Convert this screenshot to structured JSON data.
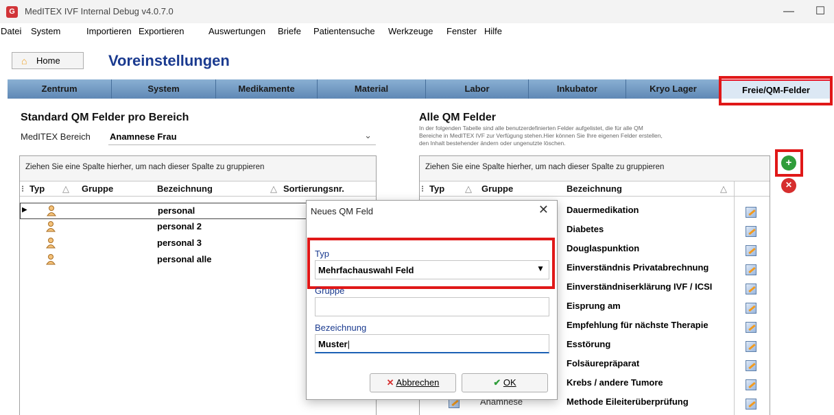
{
  "window": {
    "title": "MedITEX IVF Internal Debug v4.0.7.0",
    "minimize_glyph": "—",
    "maximize_glyph": "☐"
  },
  "menu": [
    "Datei",
    "System",
    "Importieren",
    "Exportieren",
    "Auswertungen",
    "Briefe",
    "Patientensuche",
    "Werkzeuge",
    "Fenster",
    "Hilfe"
  ],
  "home_label": "Home",
  "page_title": "Voreinstellungen",
  "tabs": [
    "Zentrum",
    "System",
    "Medikamente",
    "Material",
    "Labor",
    "Inkubator",
    "Kryo Lager",
    "Freie/QM-Felder"
  ],
  "active_tab": "Freie/QM-Felder",
  "left": {
    "title": "Standard QM Felder pro Bereich",
    "bereich_label": "MedITEX Bereich",
    "bereich_value": "Anamnese Frau",
    "group_hint": "Ziehen Sie eine Spalte hierher, um nach dieser Spalte zu gruppieren",
    "columns": {
      "typ": "Typ",
      "gruppe": "Gruppe",
      "bezeichnung": "Bezeichnung",
      "sortierung": "Sortierungsnr."
    },
    "rows": [
      "personal",
      "personal 2",
      "personal 3",
      "personal alle"
    ]
  },
  "right": {
    "title": "Alle QM Felder",
    "desc": [
      "In der folgenden Tabelle sind alle benutzerdefinierten Felder aufgelistet, die für alle QM",
      "Bereiche in MedITEX IVF zur Verfügung stehen.Hier können Sie Ihre eigenen Felder erstellen,",
      "den Inhalt bestehender ändern oder ungenutzte löschen."
    ],
    "group_hint": "Ziehen Sie eine Spalte hierher, um nach dieser Spalte zu gruppieren",
    "columns": {
      "typ": "Typ",
      "gruppe": "Gruppe",
      "bezeichnung": "Bezeichnung"
    },
    "rows": [
      {
        "gruppe": "",
        "bezeichnung": "Dauermedikation"
      },
      {
        "gruppe": "",
        "bezeichnung": "Diabetes"
      },
      {
        "gruppe": "",
        "bezeichnung": "Douglaspunktion"
      },
      {
        "gruppe": "",
        "bezeichnung": "Einverständnis Privatabrechnung"
      },
      {
        "gruppe": "",
        "bezeichnung": "Einverständniserklärung IVF / ICSI"
      },
      {
        "gruppe": "",
        "bezeichnung": "Eisprung am"
      },
      {
        "gruppe": "",
        "bezeichnung": "Empfehlung für nächste Therapie"
      },
      {
        "gruppe": "",
        "bezeichnung": "Esstörung"
      },
      {
        "gruppe": "",
        "bezeichnung": "Folsäurepräparat"
      },
      {
        "gruppe": "",
        "bezeichnung": "Krebs / andere Tumore"
      },
      {
        "gruppe": "Anamnese",
        "bezeichnung": "Methode Eileiterüberprüfung"
      }
    ],
    "add_glyph": "+",
    "delete_glyph": "✕"
  },
  "dialog": {
    "title": "Neues QM Feld",
    "close_glyph": "✕",
    "typ_label": "Typ",
    "typ_value": "Mehrfachauswahl Feld",
    "gruppe_label": "Gruppe",
    "gruppe_value": "",
    "bezeichnung_label": "Bezeichnung",
    "bezeichnung_value": "Muster",
    "cancel_label": "Abbrechen",
    "ok_label": "OK"
  },
  "colors": {
    "accent_red": "#e01818",
    "title_blue": "#1a3a8f",
    "tab_blue": "#6f96c2"
  }
}
